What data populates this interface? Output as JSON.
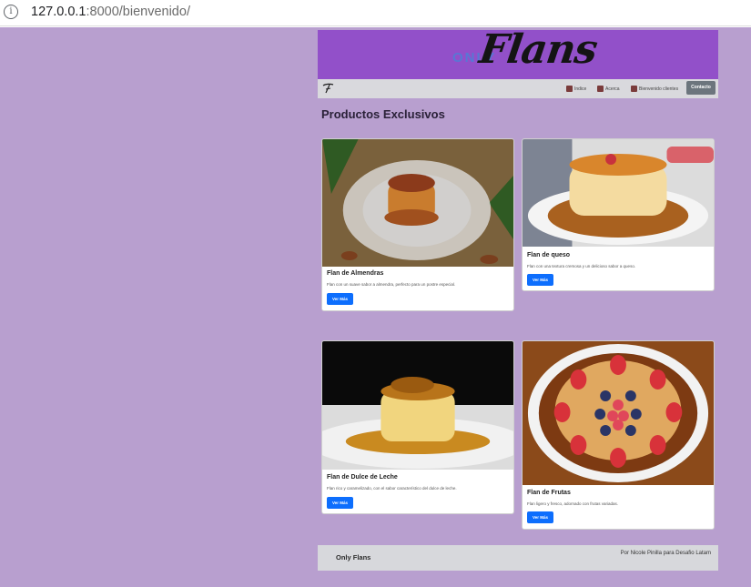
{
  "browser": {
    "url_host": "127.0.0.1",
    "url_rest": ":8000/bienvenido/"
  },
  "brand": {
    "only": "ONLY",
    "flans": "Flans"
  },
  "navbar": {
    "items": [
      {
        "label": "Indice",
        "icon": "door-icon"
      },
      {
        "label": "Acerca",
        "icon": "id-card-icon"
      },
      {
        "label": "Bienvenido clientes",
        "icon": "door-open-icon"
      }
    ],
    "contact_label": "Contacto"
  },
  "section_title": "Productos Exclusivos",
  "products": [
    {
      "title": "Flan de Almendras",
      "text": "Flan con un suave sabor a almendra, perfecto para un postre especial.",
      "button": "Ver Más"
    },
    {
      "title": "Flan de queso",
      "text": "Flan con una textura cremosa y un delicioso sabor a queso.",
      "button": "Ver Más"
    },
    {
      "title": "Flan de Dulce de Leche",
      "text": "Flan rico y caramelizado, con el sabor característico del dulce de leche.",
      "button": "Ver Más"
    },
    {
      "title": "Flan de Frutas",
      "text": "Flan ligero y fresco, adornado con frutas variadas.",
      "button": "Ver Más"
    }
  ],
  "footer": {
    "brand": "Only Flans",
    "credit": "Por Nicole Pinilla para Desafio Latam"
  },
  "colors": {
    "page_bg": "#b89fcf",
    "banner_bg": "#9250c9",
    "navbar_bg": "#d9d9dd",
    "primary_button": "#0d6efd",
    "contact_button": "#6c757d"
  }
}
